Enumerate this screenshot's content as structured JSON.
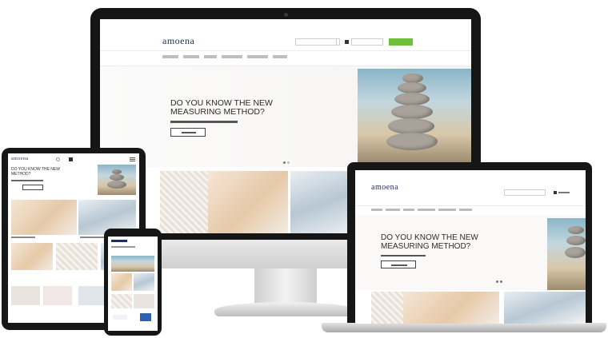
{
  "brand": {
    "logo": "amoena",
    "accent": "#6fbf3c",
    "logo_color": "#1f2d57"
  },
  "desktop": {
    "toplinks": [
      "",
      "",
      ""
    ],
    "search_placeholder": "",
    "cart_label": "",
    "green_button": "",
    "nav": [
      "",
      "",
      "",
      "",
      "",
      ""
    ],
    "hero_title_line1": "DO YOU KNOW THE NEW",
    "hero_title_line2": "MEASURING METHOD?",
    "hero_sub": "",
    "hero_button": ""
  },
  "laptop": {
    "logo": "amoena",
    "hero_title_line1": "DO YOU KNOW THE NEW",
    "hero_title_line2": "MEASURING METHOD?"
  },
  "tablet": {
    "logo": "amoena",
    "hero_title_line1": "DO YOU KNOW THE NEW",
    "hero_title_line2": "METHOD?"
  }
}
